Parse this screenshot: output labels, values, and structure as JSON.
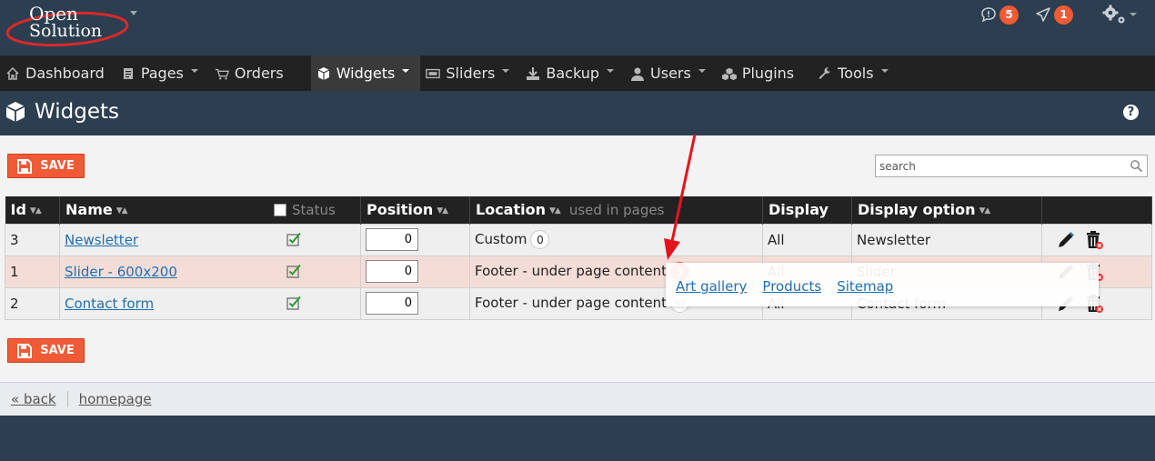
{
  "brand": {
    "line1": "Open",
    "line2": "Solution",
    "accent": "#d82a2a"
  },
  "top": {
    "messages_count": "5",
    "notifications_count": "1"
  },
  "nav": [
    {
      "label": "Dashboard",
      "icon": "home-icon"
    },
    {
      "label": "Pages",
      "icon": "pages-icon"
    },
    {
      "label": "Orders",
      "icon": "cart-icon"
    },
    {
      "label": "Widgets",
      "icon": "cube-icon"
    },
    {
      "label": "Sliders",
      "icon": "slider-icon"
    },
    {
      "label": "Backup",
      "icon": "download-icon"
    },
    {
      "label": "Users",
      "icon": "user-icon"
    },
    {
      "label": "Plugins",
      "icon": "cubes-icon"
    },
    {
      "label": "Tools",
      "icon": "wrench-icon"
    }
  ],
  "page": {
    "title": "Widgets",
    "help": "?"
  },
  "toolbar": {
    "save_label": "SAVE",
    "search_placeholder": "search"
  },
  "table": {
    "headers": {
      "id": "Id",
      "name": "Name",
      "status": "Status",
      "position": "Position",
      "location": "Location",
      "location_sub": "used in pages",
      "display": "Display",
      "display_option": "Display option"
    },
    "rows": [
      {
        "id": "3",
        "name": "Newsletter",
        "position": "0",
        "location": "Custom",
        "pages": "0",
        "display": "All",
        "display_option": "Newsletter"
      },
      {
        "id": "1",
        "name": "Slider - 600x200",
        "position": "0",
        "location": "Footer - under page content",
        "pages": "3",
        "display": "All",
        "display_option": "Slider"
      },
      {
        "id": "2",
        "name": "Contact form",
        "position": "0",
        "location": "Footer - under page content",
        "pages": "all",
        "display": "All",
        "display_option": "Contact form"
      }
    ]
  },
  "popup": {
    "links": [
      "Art gallery",
      "Products",
      "Sitemap"
    ]
  },
  "footer": {
    "back": "« back",
    "home": "homepage"
  },
  "colors": {
    "accent": "#f05a36",
    "header_bg": "#2c3e50",
    "nav_bg": "#222222",
    "link": "#1f6fb2",
    "highlight_row": "#f5ddd7"
  }
}
